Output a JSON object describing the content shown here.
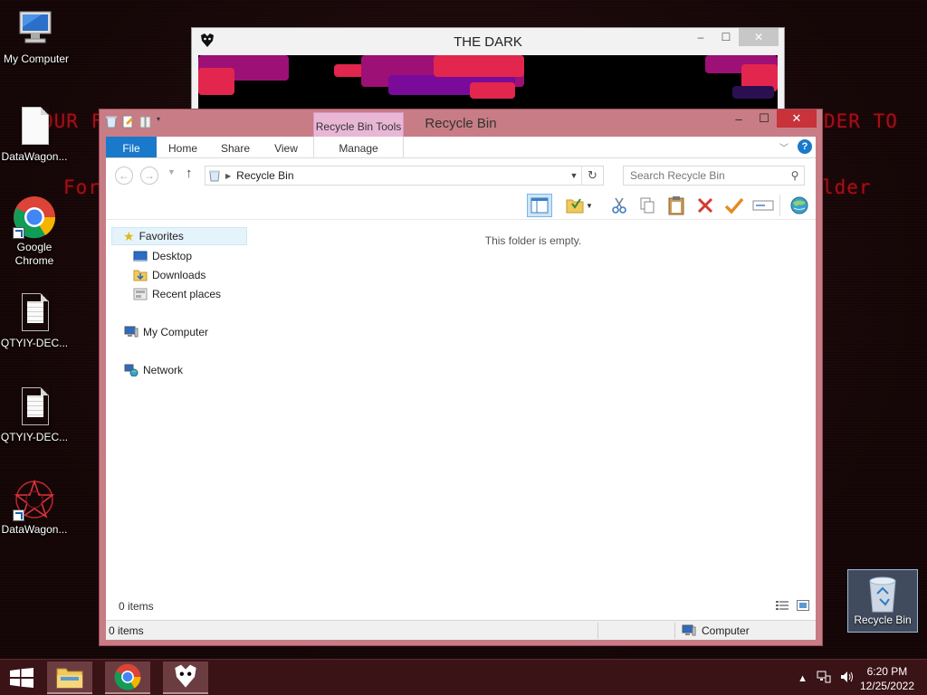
{
  "desktop": {
    "icons": [
      {
        "label": "My Computer"
      },
      {
        "label": "DataWagon..."
      },
      {
        "label": "Google Chrome"
      },
      {
        "label": "QTYIY-DEC..."
      },
      {
        "label": "QTYIY-DEC..."
      },
      {
        "label": "DataWagon..."
      }
    ],
    "recycle_bin": {
      "label": "Recycle Bin"
    },
    "ransom_line1_left": "OUR F",
    "ransom_line1_right": "DER TO",
    "ransom_line2_left": "For",
    "ransom_line2_right": "lder"
  },
  "dark_window": {
    "title": "THE DARK",
    "controls": {
      "minimize": "–",
      "maximize": "☐",
      "close": "✕"
    }
  },
  "explorer": {
    "title": "Recycle Bin",
    "context_tab": "Recycle Bin Tools",
    "controls": {
      "minimize": "–",
      "maximize": "☐",
      "close": "✕"
    },
    "ribbon_tabs": {
      "file": "File",
      "home": "Home",
      "share": "Share",
      "view": "View",
      "manage": "Manage"
    },
    "help": "?",
    "address": {
      "path": "Recycle Bin"
    },
    "search": {
      "placeholder": "Search Recycle Bin"
    },
    "nav_pane": {
      "favorites": "Favorites",
      "desktop": "Desktop",
      "downloads": "Downloads",
      "recent": "Recent places",
      "computer": "My Computer",
      "network": "Network"
    },
    "empty_message": "This folder is empty.",
    "item_count": "0 items",
    "status": {
      "items": "0 items",
      "location": "Computer"
    }
  },
  "taskbar": {
    "time": "6:20 PM",
    "date": "12/25/2022"
  },
  "colors": {
    "accent": "#1979ca",
    "window_frame": "#c87c85",
    "close_red": "#c7323b",
    "context_tab": "#e9b7d6",
    "taskbar": "#3a1317",
    "ransom_red": "#b3121c"
  }
}
